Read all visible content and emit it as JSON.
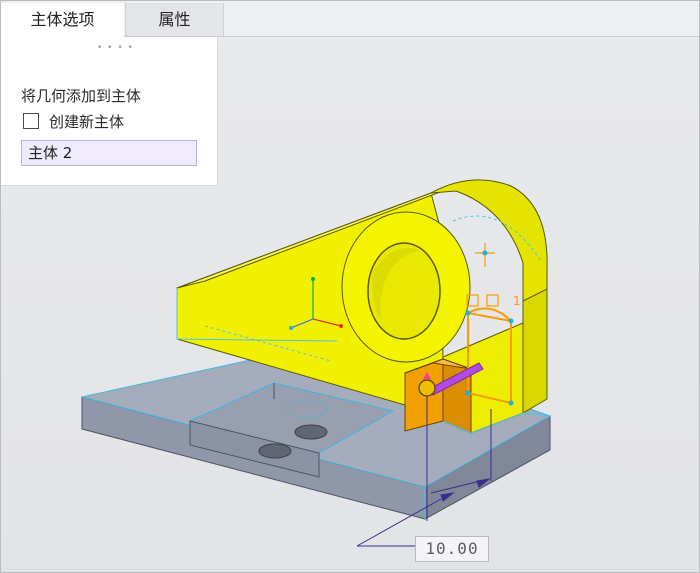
{
  "tabs": [
    {
      "label": "主体选项",
      "active": true
    },
    {
      "label": "属性",
      "active": false
    }
  ],
  "panel": {
    "section_label": "将几何添加到主体",
    "new_body_checkbox": {
      "label": "创建新主体",
      "checked": false
    },
    "body_field": {
      "value": "主体 2"
    }
  },
  "viewport": {
    "dimension_value": "10.00",
    "colors": {
      "background": "#e4e5e8",
      "new_feature": "#f0f000",
      "base": "#98a0b2",
      "cut": "#f0a000",
      "selection": "#ff9900",
      "edges": "#49c6e5"
    }
  }
}
